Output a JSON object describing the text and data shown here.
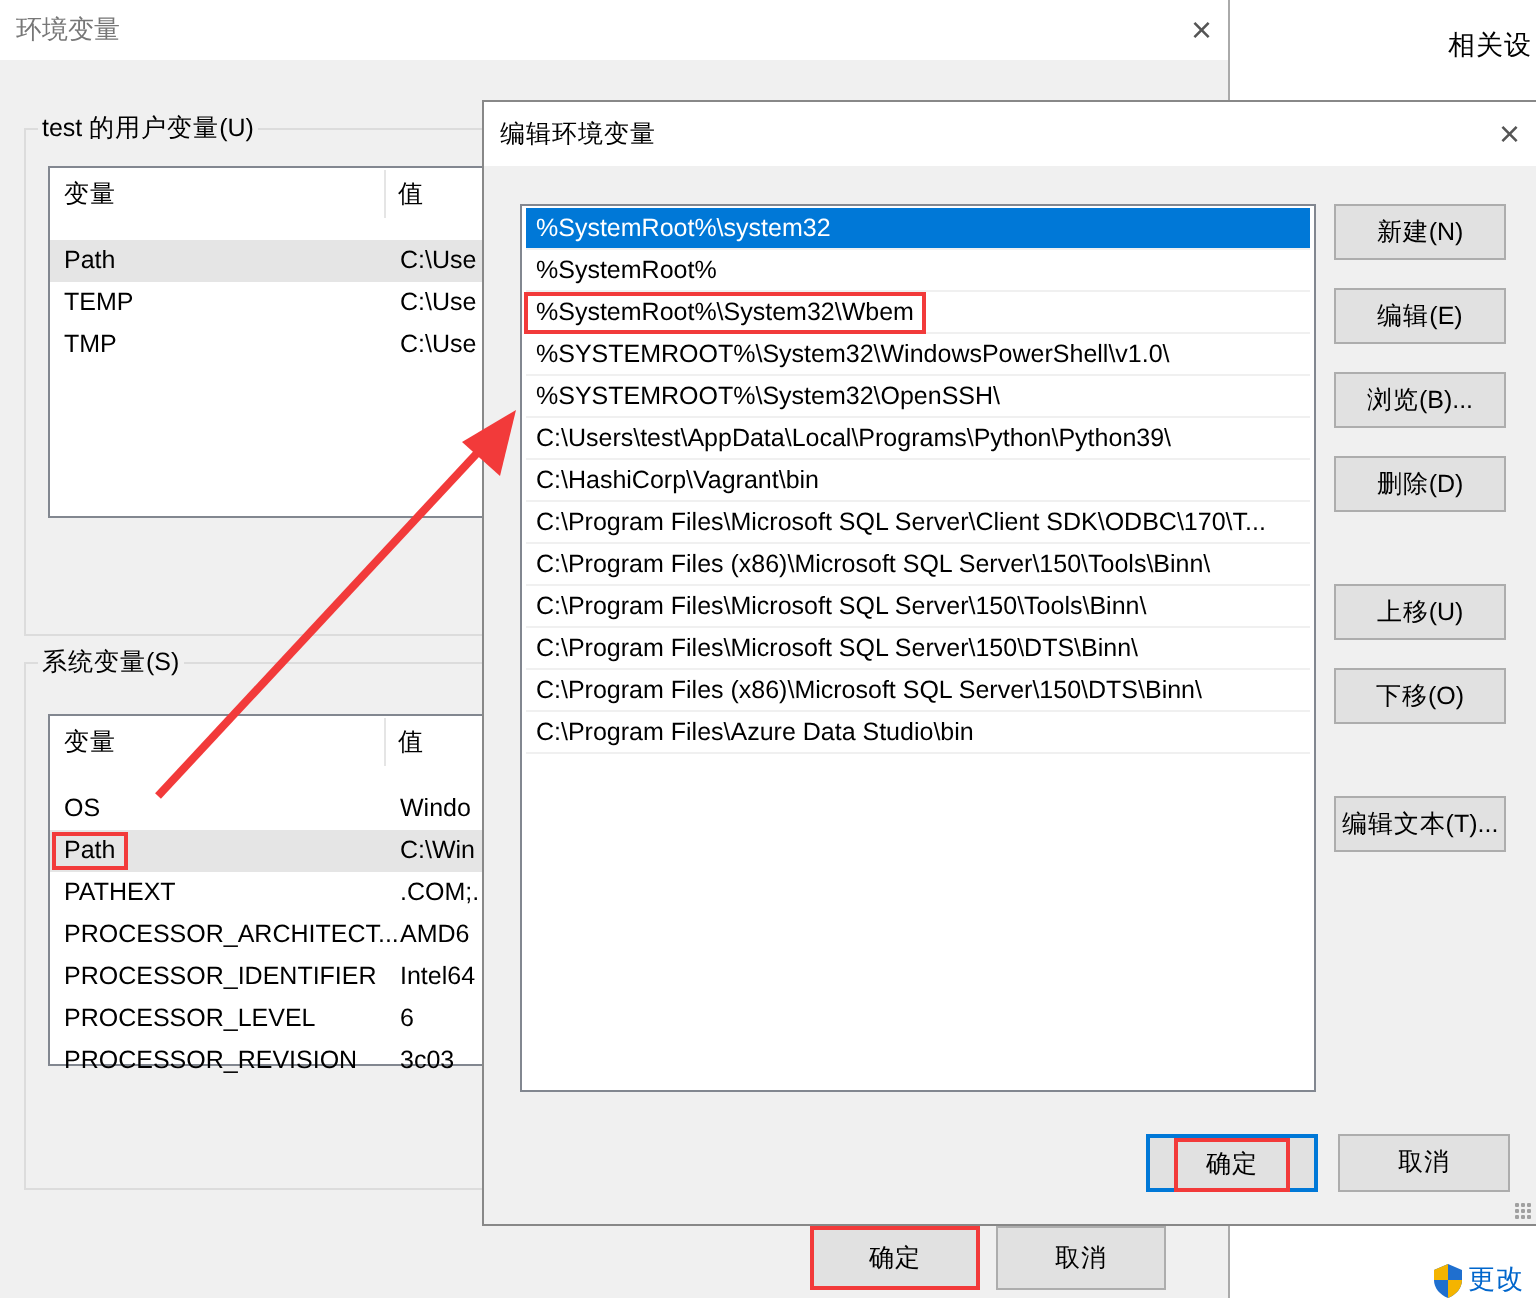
{
  "main_window": {
    "title": "环境变量",
    "close_glyph": "×",
    "user_group": {
      "label": "test 的用户变量(U)",
      "columns": [
        "变量",
        "值"
      ],
      "rows": [
        {
          "name": "Path",
          "value": "C:\\Use",
          "selected": true,
          "annotated": false
        },
        {
          "name": "TEMP",
          "value": "C:\\Use",
          "selected": false,
          "annotated": false
        },
        {
          "name": "TMP",
          "value": "C:\\Use",
          "selected": false,
          "annotated": false
        }
      ]
    },
    "system_group": {
      "label": "系统变量(S)",
      "columns": [
        "变量",
        "值"
      ],
      "rows": [
        {
          "name": "OS",
          "value": "Windo",
          "selected": false,
          "annotated": false
        },
        {
          "name": "Path",
          "value": "C:\\Win",
          "selected": true,
          "annotated": true
        },
        {
          "name": "PATHEXT",
          "value": ".COM;.",
          "selected": false,
          "annotated": false
        },
        {
          "name": "PROCESSOR_ARCHITECT...",
          "value": "AMD6",
          "selected": false,
          "annotated": false
        },
        {
          "name": "PROCESSOR_IDENTIFIER",
          "value": "Intel64",
          "selected": false,
          "annotated": false
        },
        {
          "name": "PROCESSOR_LEVEL",
          "value": "6",
          "selected": false,
          "annotated": false
        },
        {
          "name": "PROCESSOR_REVISION",
          "value": "3c03",
          "selected": false,
          "annotated": false
        }
      ]
    },
    "buttons": [
      {
        "label": "确定",
        "annotated": true
      },
      {
        "label": "取消",
        "annotated": false
      }
    ]
  },
  "side_panel": {
    "heading": "相关设",
    "bottom_link": "更改"
  },
  "edit_dialog": {
    "title": "编辑环境变量",
    "close_glyph": "×",
    "paths": [
      {
        "text": "%SystemRoot%\\system32",
        "selected": true,
        "annotated": false
      },
      {
        "text": "%SystemRoot%",
        "selected": false,
        "annotated": false
      },
      {
        "text": "%SystemRoot%\\System32\\Wbem",
        "selected": false,
        "annotated": true
      },
      {
        "text": "%SYSTEMROOT%\\System32\\WindowsPowerShell\\v1.0\\",
        "selected": false,
        "annotated": false
      },
      {
        "text": "%SYSTEMROOT%\\System32\\OpenSSH\\",
        "selected": false,
        "annotated": false
      },
      {
        "text": "C:\\Users\\test\\AppData\\Local\\Programs\\Python\\Python39\\",
        "selected": false,
        "annotated": false
      },
      {
        "text": "C:\\HashiCorp\\Vagrant\\bin",
        "selected": false,
        "annotated": false
      },
      {
        "text": "C:\\Program Files\\Microsoft SQL Server\\Client SDK\\ODBC\\170\\T...",
        "selected": false,
        "annotated": false
      },
      {
        "text": "C:\\Program Files (x86)\\Microsoft SQL Server\\150\\Tools\\Binn\\",
        "selected": false,
        "annotated": false
      },
      {
        "text": "C:\\Program Files\\Microsoft SQL Server\\150\\Tools\\Binn\\",
        "selected": false,
        "annotated": false
      },
      {
        "text": "C:\\Program Files\\Microsoft SQL Server\\150\\DTS\\Binn\\",
        "selected": false,
        "annotated": false
      },
      {
        "text": "C:\\Program Files (x86)\\Microsoft SQL Server\\150\\DTS\\Binn\\",
        "selected": false,
        "annotated": false
      },
      {
        "text": "C:\\Program Files\\Azure Data Studio\\bin",
        "selected": false,
        "annotated": false
      }
    ],
    "side_button_groups": [
      [
        "新建(N)",
        "编辑(E)",
        "浏览(B)...",
        "删除(D)"
      ],
      [
        "上移(U)",
        "下移(O)"
      ],
      [
        "编辑文本(T)..."
      ]
    ],
    "buttons": [
      {
        "label": "确定",
        "default": true,
        "annotated": true
      },
      {
        "label": "取消",
        "default": false,
        "annotated": false
      }
    ]
  }
}
